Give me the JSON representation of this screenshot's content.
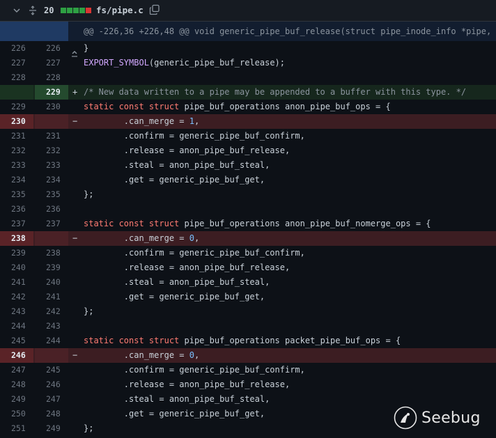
{
  "file": {
    "changes_count": "20",
    "diffstat": [
      "added",
      "added",
      "added",
      "added",
      "deleted"
    ],
    "path": "fs/pipe.c",
    "colors": {
      "added": "#2ea043",
      "deleted": "#da3633"
    }
  },
  "hunk": {
    "header": "@@ -226,36 +226,48 @@ void generic_pipe_buf_release(struct pipe_inode_info *pipe,"
  },
  "lines": [
    {
      "type": "ctx",
      "old": "226",
      "new": "226",
      "marker": "",
      "code": [
        [
          "}",
          ""
        ]
      ]
    },
    {
      "type": "ctx",
      "old": "227",
      "new": "227",
      "marker": "",
      "code": [
        [
          "EXPORT_SYMBOL",
          "fn"
        ],
        [
          "(generic_pipe_buf_release);",
          ""
        ]
      ]
    },
    {
      "type": "ctx",
      "old": "228",
      "new": "228",
      "marker": "",
      "code": []
    },
    {
      "type": "add",
      "old": "",
      "new": "229",
      "marker": "+",
      "code": [
        [
          "/* New data written to a pipe may be appended to a buffer with this type. */",
          "cmt"
        ]
      ]
    },
    {
      "type": "ctx",
      "old": "229",
      "new": "230",
      "marker": "",
      "code": [
        [
          "static const struct",
          "kw"
        ],
        [
          " pipe_buf_operations anon_pipe_buf_ops = {",
          ""
        ]
      ]
    },
    {
      "type": "del",
      "old": "230",
      "new": "",
      "marker": "−",
      "code": [
        [
          "        .can_merge = ",
          ""
        ],
        [
          "1",
          "num"
        ],
        [
          ",",
          ""
        ]
      ]
    },
    {
      "type": "ctx",
      "old": "231",
      "new": "231",
      "marker": "",
      "code": [
        [
          "        .confirm = generic_pipe_buf_confirm,",
          ""
        ]
      ]
    },
    {
      "type": "ctx",
      "old": "232",
      "new": "232",
      "marker": "",
      "code": [
        [
          "        .release = anon_pipe_buf_release,",
          ""
        ]
      ]
    },
    {
      "type": "ctx",
      "old": "233",
      "new": "233",
      "marker": "",
      "code": [
        [
          "        .steal = anon_pipe_buf_steal,",
          ""
        ]
      ]
    },
    {
      "type": "ctx",
      "old": "234",
      "new": "234",
      "marker": "",
      "code": [
        [
          "        .get = generic_pipe_buf_get,",
          ""
        ]
      ]
    },
    {
      "type": "ctx",
      "old": "235",
      "new": "235",
      "marker": "",
      "code": [
        [
          "};",
          ""
        ]
      ]
    },
    {
      "type": "ctx",
      "old": "236",
      "new": "236",
      "marker": "",
      "code": []
    },
    {
      "type": "ctx",
      "old": "237",
      "new": "237",
      "marker": "",
      "code": [
        [
          "static const struct",
          "kw"
        ],
        [
          " pipe_buf_operations anon_pipe_buf_nomerge_ops = {",
          ""
        ]
      ]
    },
    {
      "type": "del",
      "old": "238",
      "new": "",
      "marker": "−",
      "code": [
        [
          "        .can_merge = ",
          ""
        ],
        [
          "0",
          "num"
        ],
        [
          ",",
          ""
        ]
      ]
    },
    {
      "type": "ctx",
      "old": "239",
      "new": "238",
      "marker": "",
      "code": [
        [
          "        .confirm = generic_pipe_buf_confirm,",
          ""
        ]
      ]
    },
    {
      "type": "ctx",
      "old": "240",
      "new": "239",
      "marker": "",
      "code": [
        [
          "        .release = anon_pipe_buf_release,",
          ""
        ]
      ]
    },
    {
      "type": "ctx",
      "old": "241",
      "new": "240",
      "marker": "",
      "code": [
        [
          "        .steal = anon_pipe_buf_steal,",
          ""
        ]
      ]
    },
    {
      "type": "ctx",
      "old": "242",
      "new": "241",
      "marker": "",
      "code": [
        [
          "        .get = generic_pipe_buf_get,",
          ""
        ]
      ]
    },
    {
      "type": "ctx",
      "old": "243",
      "new": "242",
      "marker": "",
      "code": [
        [
          "};",
          ""
        ]
      ]
    },
    {
      "type": "ctx",
      "old": "244",
      "new": "243",
      "marker": "",
      "code": []
    },
    {
      "type": "ctx",
      "old": "245",
      "new": "244",
      "marker": "",
      "code": [
        [
          "static const struct",
          "kw"
        ],
        [
          " pipe_buf_operations packet_pipe_buf_ops = {",
          ""
        ]
      ]
    },
    {
      "type": "del",
      "old": "246",
      "new": "",
      "marker": "−",
      "code": [
        [
          "        .can_merge = ",
          ""
        ],
        [
          "0",
          "num"
        ],
        [
          ",",
          ""
        ]
      ]
    },
    {
      "type": "ctx",
      "old": "247",
      "new": "245",
      "marker": "",
      "code": [
        [
          "        .confirm = generic_pipe_buf_confirm,",
          ""
        ]
      ]
    },
    {
      "type": "ctx",
      "old": "248",
      "new": "246",
      "marker": "",
      "code": [
        [
          "        .release = anon_pipe_buf_release,",
          ""
        ]
      ]
    },
    {
      "type": "ctx",
      "old": "249",
      "new": "247",
      "marker": "",
      "code": [
        [
          "        .steal = anon_pipe_buf_steal,",
          ""
        ]
      ]
    },
    {
      "type": "ctx",
      "old": "250",
      "new": "248",
      "marker": "",
      "code": [
        [
          "        .get = generic_pipe_buf_get,",
          ""
        ]
      ]
    },
    {
      "type": "ctx",
      "old": "251",
      "new": "249",
      "marker": "",
      "code": [
        [
          "};",
          ""
        ]
      ]
    }
  ],
  "watermark": {
    "text": "Seebug"
  }
}
